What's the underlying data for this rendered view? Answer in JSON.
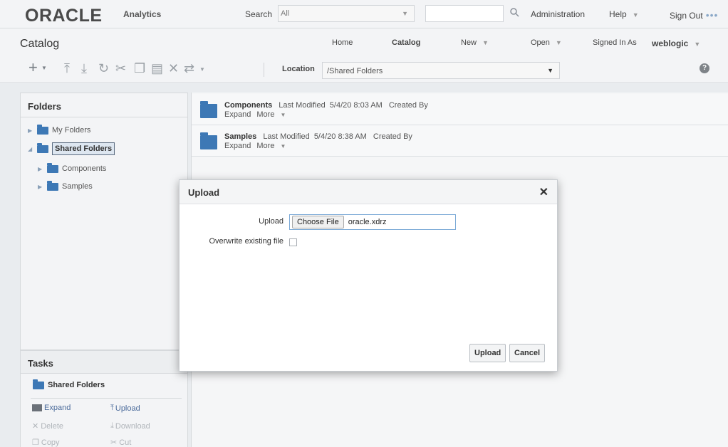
{
  "header": {
    "logo": "ORACLE",
    "logo_sub": "Analytics",
    "search_label": "Search",
    "search_scope": "All",
    "search_value": "",
    "links": {
      "administration": "Administration",
      "help": "Help",
      "sign_out": "Sign Out"
    }
  },
  "subheader": {
    "title": "Catalog",
    "nav": {
      "home": "Home",
      "catalog": "Catalog",
      "new": "New",
      "open": "Open",
      "signed_in_as": "Signed In As",
      "user": "weblogic"
    }
  },
  "toolbar": {
    "location_label": "Location",
    "location_value": "/Shared Folders"
  },
  "folders": {
    "title": "Folders",
    "tree": [
      {
        "label": "My Folders"
      },
      {
        "label": "Shared Folders"
      },
      {
        "label": "Components"
      },
      {
        "label": "Samples"
      }
    ]
  },
  "tasks": {
    "title": "Tasks",
    "folder": "Shared Folders",
    "items": [
      {
        "label": "Expand",
        "enabled": true
      },
      {
        "label": "Upload",
        "enabled": true
      },
      {
        "label": "Delete",
        "enabled": false
      },
      {
        "label": "Download",
        "enabled": false
      },
      {
        "label": "Copy",
        "enabled": false
      },
      {
        "label": "Cut",
        "enabled": false
      }
    ]
  },
  "catalog_items": [
    {
      "name": "Components",
      "last_modified_label": "Last Modified",
      "last_modified": "5/4/20 8:03 AM",
      "created_by_label": "Created By",
      "expand": "Expand",
      "more": "More"
    },
    {
      "name": "Samples",
      "last_modified_label": "Last Modified",
      "last_modified": "5/4/20 8:38 AM",
      "created_by_label": "Created By",
      "expand": "Expand",
      "more": "More"
    }
  ],
  "dialog": {
    "title": "Upload",
    "upload_label": "Upload",
    "choose_file": "Choose File",
    "file_name": "oracle.xdrz",
    "overwrite_label": "Overwrite existing file",
    "overwrite_checked": false,
    "upload_button": "Upload",
    "cancel_button": "Cancel"
  },
  "colors": {
    "folder_blue": "#3d78b5",
    "link_blue": "#4a6a9a",
    "background": "#e9ecef"
  }
}
